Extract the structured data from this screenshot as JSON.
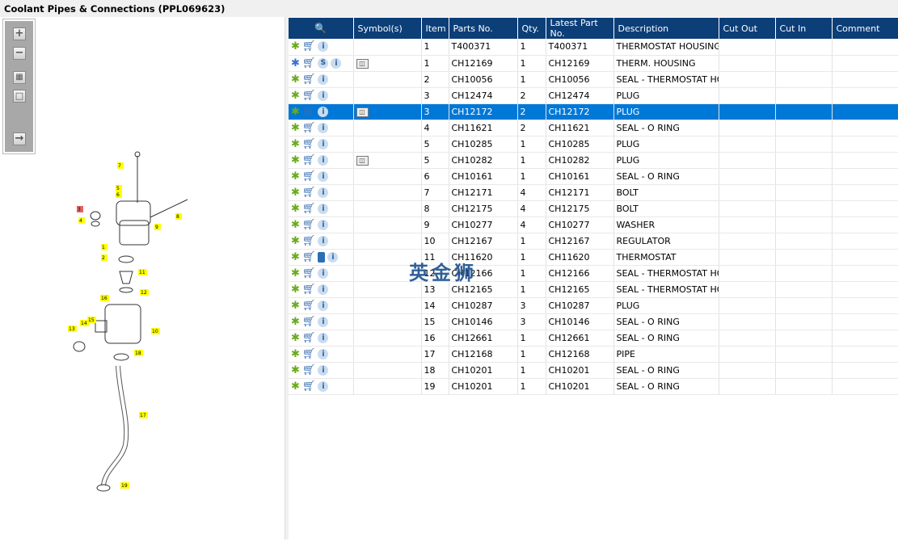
{
  "title": "Coolant Pipes & Connections (PPL069623)",
  "toolbar": {
    "zoom_in": "+",
    "zoom_out": "−",
    "fit": "▦",
    "single": "□",
    "export": "→"
  },
  "columns": [
    "",
    "Symbol(s)",
    "Item",
    "Parts No.",
    "Qty.",
    "Latest Part No.",
    "Description",
    "Cut Out",
    "Cut In",
    "Comment"
  ],
  "rows": [
    {
      "icons": [
        "gear",
        "cart",
        "info"
      ],
      "symbol": "",
      "item": "1",
      "part": "T400371",
      "qty": "1",
      "latest": "T400371",
      "desc": "THERMOSTAT HOUSING"
    },
    {
      "icons": [
        "gears",
        "cart",
        "s",
        "info"
      ],
      "symbol": "view",
      "item": "1",
      "part": "CH12169",
      "qty": "1",
      "latest": "CH12169",
      "desc": "THERM. HOUSING"
    },
    {
      "icons": [
        "gear",
        "cart",
        "info"
      ],
      "symbol": "",
      "item": "2",
      "part": "CH10056",
      "qty": "1",
      "latest": "CH10056",
      "desc": "SEAL - THERMOSTAT HO"
    },
    {
      "icons": [
        "gear",
        "cart",
        "info"
      ],
      "symbol": "",
      "item": "3",
      "part": "CH12474",
      "qty": "2",
      "latest": "CH12474",
      "desc": "PLUG"
    },
    {
      "icons": [
        "gear",
        "cart",
        "info"
      ],
      "symbol": "view",
      "item": "3",
      "part": "CH12172",
      "qty": "2",
      "latest": "CH12172",
      "desc": "PLUG",
      "selected": true
    },
    {
      "icons": [
        "gear",
        "cart",
        "info"
      ],
      "symbol": "",
      "item": "4",
      "part": "CH11621",
      "qty": "2",
      "latest": "CH11621",
      "desc": "SEAL - O RING"
    },
    {
      "icons": [
        "gear",
        "cart",
        "info"
      ],
      "symbol": "",
      "item": "5",
      "part": "CH10285",
      "qty": "1",
      "latest": "CH10285",
      "desc": "PLUG"
    },
    {
      "icons": [
        "gear",
        "cart",
        "info"
      ],
      "symbol": "view",
      "item": "5",
      "part": "CH10282",
      "qty": "1",
      "latest": "CH10282",
      "desc": "PLUG"
    },
    {
      "icons": [
        "gear",
        "cart",
        "info"
      ],
      "symbol": "",
      "item": "6",
      "part": "CH10161",
      "qty": "1",
      "latest": "CH10161",
      "desc": "SEAL - O RING"
    },
    {
      "icons": [
        "gear",
        "cart",
        "info"
      ],
      "symbol": "",
      "item": "7",
      "part": "CH12171",
      "qty": "4",
      "latest": "CH12171",
      "desc": "BOLT"
    },
    {
      "icons": [
        "gear",
        "cart",
        "info"
      ],
      "symbol": "",
      "item": "8",
      "part": "CH12175",
      "qty": "4",
      "latest": "CH12175",
      "desc": "BOLT"
    },
    {
      "icons": [
        "gear",
        "cart",
        "info"
      ],
      "symbol": "",
      "item": "9",
      "part": "CH10277",
      "qty": "4",
      "latest": "CH10277",
      "desc": "WASHER"
    },
    {
      "icons": [
        "gear",
        "cart",
        "info"
      ],
      "symbol": "",
      "item": "10",
      "part": "CH12167",
      "qty": "1",
      "latest": "CH12167",
      "desc": "REGULATOR"
    },
    {
      "icons": [
        "gear",
        "cart",
        "book",
        "info"
      ],
      "symbol": "",
      "item": "11",
      "part": "CH11620",
      "qty": "1",
      "latest": "CH11620",
      "desc": "THERMOSTAT"
    },
    {
      "icons": [
        "gear",
        "cart",
        "info"
      ],
      "symbol": "",
      "item": "12",
      "part": "CH12166",
      "qty": "1",
      "latest": "CH12166",
      "desc": "SEAL - THERMOSTAT HO"
    },
    {
      "icons": [
        "gear",
        "cart",
        "info"
      ],
      "symbol": "",
      "item": "13",
      "part": "CH12165",
      "qty": "1",
      "latest": "CH12165",
      "desc": "SEAL - THERMOSTAT HO"
    },
    {
      "icons": [
        "gear",
        "cart",
        "info"
      ],
      "symbol": "",
      "item": "14",
      "part": "CH10287",
      "qty": "3",
      "latest": "CH10287",
      "desc": "PLUG"
    },
    {
      "icons": [
        "gear",
        "cart",
        "info"
      ],
      "symbol": "",
      "item": "15",
      "part": "CH10146",
      "qty": "3",
      "latest": "CH10146",
      "desc": "SEAL - O RING"
    },
    {
      "icons": [
        "gear",
        "cart",
        "info"
      ],
      "symbol": "",
      "item": "16",
      "part": "CH12661",
      "qty": "1",
      "latest": "CH12661",
      "desc": "SEAL - O RING"
    },
    {
      "icons": [
        "gear",
        "cart",
        "info"
      ],
      "symbol": "",
      "item": "17",
      "part": "CH12168",
      "qty": "1",
      "latest": "CH12168",
      "desc": "PIPE"
    },
    {
      "icons": [
        "gear",
        "cart",
        "info"
      ],
      "symbol": "",
      "item": "18",
      "part": "CH10201",
      "qty": "1",
      "latest": "CH10201",
      "desc": "SEAL - O RING"
    },
    {
      "icons": [
        "gear",
        "cart",
        "info"
      ],
      "symbol": "",
      "item": "19",
      "part": "CH10201",
      "qty": "1",
      "latest": "CH10201",
      "desc": "SEAL - O RING"
    }
  ],
  "diagram_labels": [
    "1",
    "2",
    "3",
    "4",
    "5",
    "6",
    "7",
    "8",
    "9",
    "10",
    "11",
    "12",
    "13",
    "14",
    "15",
    "16",
    "17",
    "18",
    "19"
  ],
  "watermark": "英金狮",
  "colors": {
    "header": "#0c3e78",
    "selected": "#0078d7",
    "callout": "#ffff00"
  }
}
